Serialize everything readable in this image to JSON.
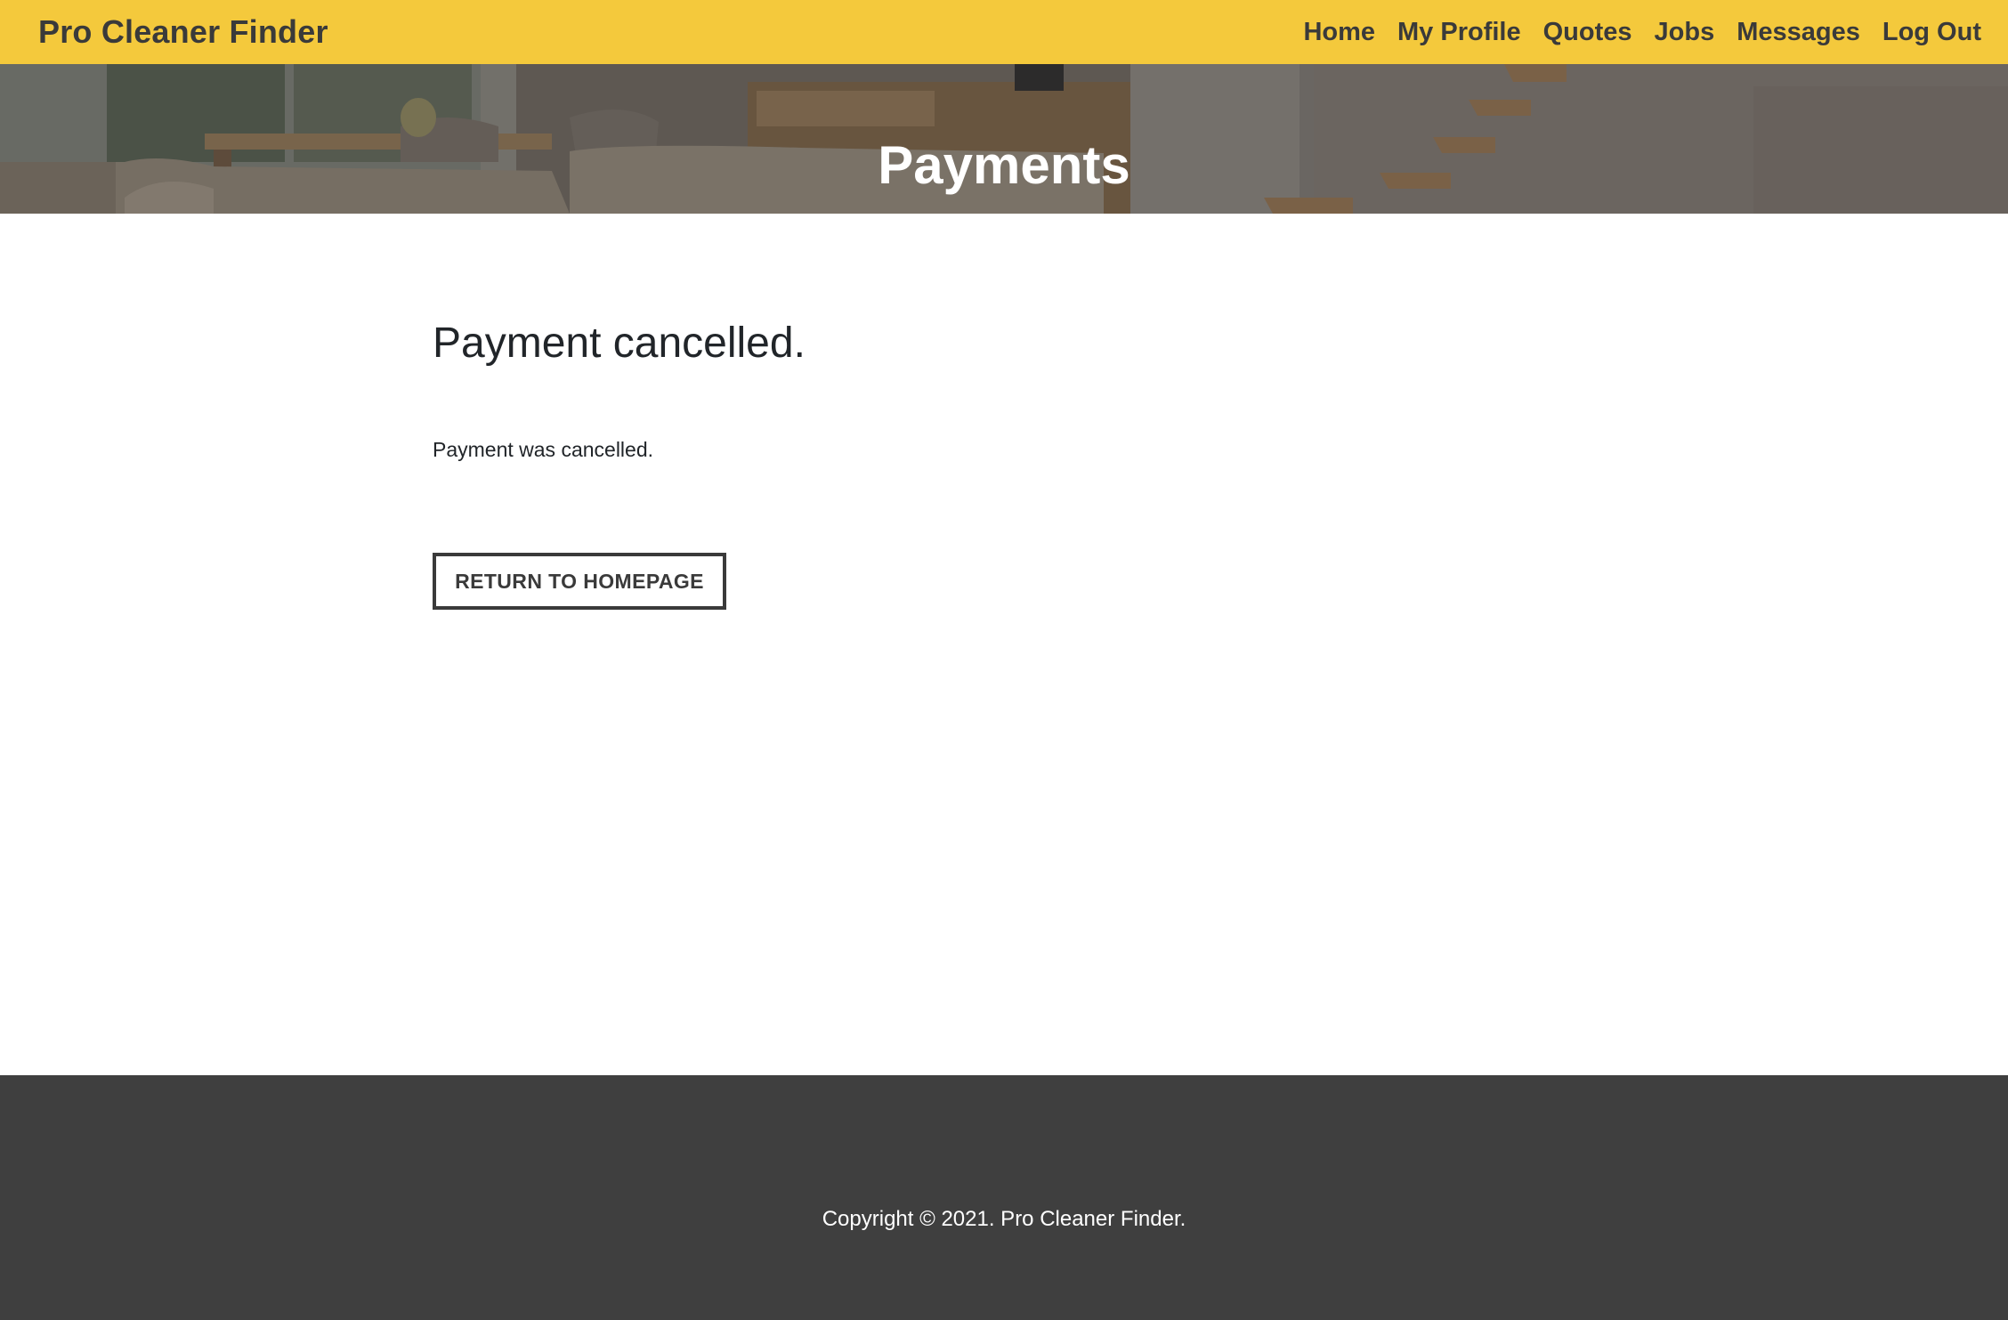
{
  "navbar": {
    "brand": "Pro Cleaner Finder",
    "links": [
      "Home",
      "My Profile",
      "Quotes",
      "Jobs",
      "Messages",
      "Log Out"
    ],
    "background_color": "#f4c93c",
    "text_color": "#3a3a3a"
  },
  "hero": {
    "title": "Payments"
  },
  "main": {
    "heading": "Payment cancelled.",
    "message": "Payment was cancelled.",
    "return_button_label": "Return to homepage"
  },
  "footer": {
    "copyright": "Copyright © 2021. Pro Cleaner Finder.",
    "background_color": "#3f3f3f"
  }
}
